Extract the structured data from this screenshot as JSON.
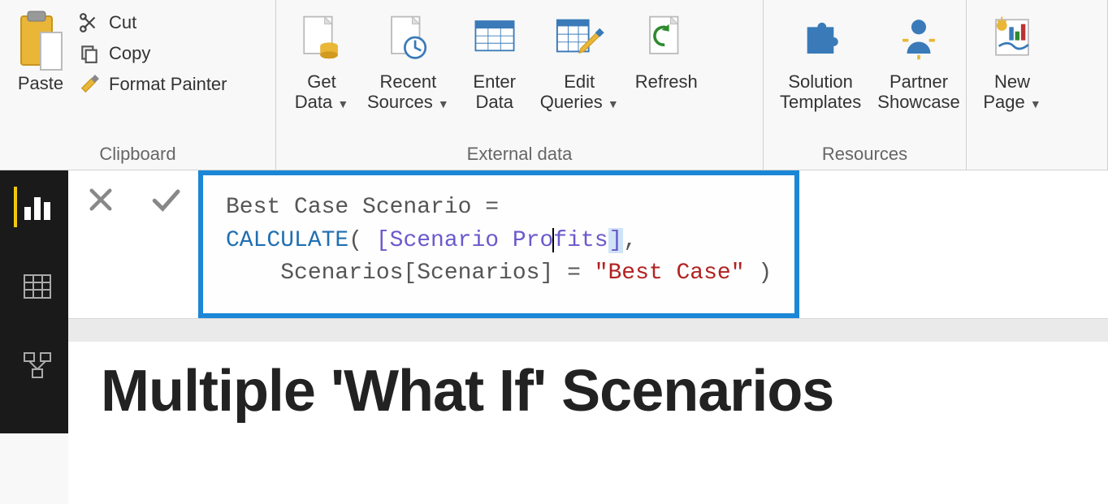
{
  "ribbon": {
    "clipboard": {
      "group_label": "Clipboard",
      "paste": "Paste",
      "cut": "Cut",
      "copy": "Copy",
      "format_painter": "Format Painter"
    },
    "external_data": {
      "group_label": "External data",
      "get_data": "Get\nData",
      "recent_sources": "Recent\nSources",
      "enter_data": "Enter\nData",
      "edit_queries": "Edit\nQueries",
      "refresh": "Refresh"
    },
    "resources": {
      "group_label": "Resources",
      "solution_templates": "Solution\nTemplates",
      "partner_showcase": "Partner\nShowcase"
    },
    "right": {
      "new_page": "New\nPage"
    }
  },
  "formula": {
    "line1": "Best Case Scenario =",
    "calc_kw": "CALCULATE",
    "after_calc": "( ",
    "scenario_prof_pre": "[Scenario Pro",
    "scenario_prof_post": "fits",
    "after_measure": ",",
    "line3_pre": "    Scenarios[Scenarios] = ",
    "line3_str": "\"Best Case\"",
    "line3_post": " )"
  },
  "report": {
    "title": "Multiple 'What If' Scenarios"
  }
}
